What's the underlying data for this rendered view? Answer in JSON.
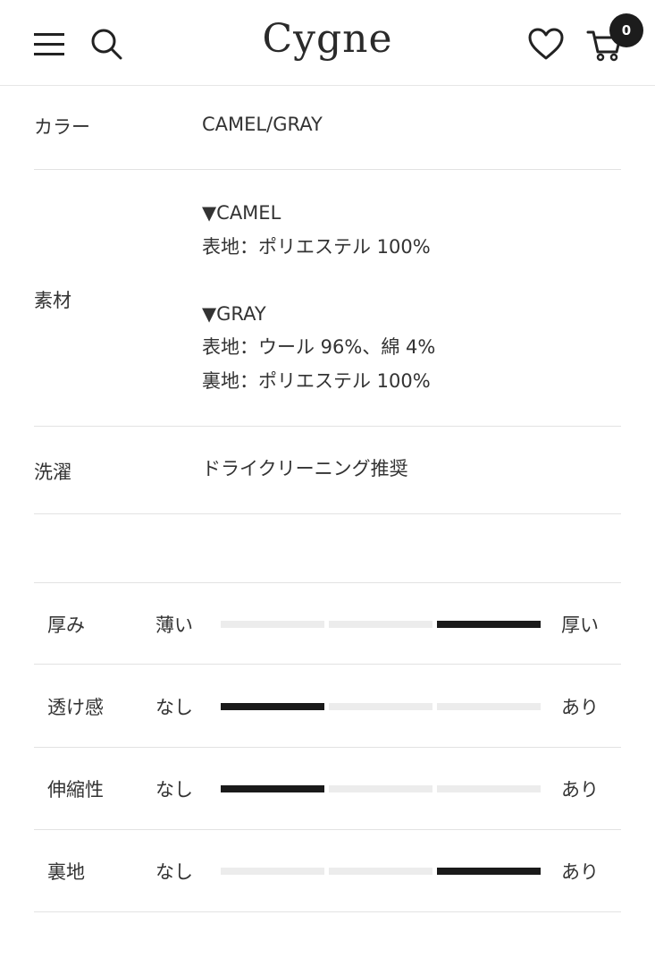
{
  "header": {
    "logo": "Cygne",
    "cart_count": "0"
  },
  "specs": {
    "color": {
      "label": "カラー",
      "value": "CAMEL/GRAY"
    },
    "material": {
      "label": "素材",
      "lines": [
        "▼CAMEL",
        "表地：ポリエステル 100%",
        "",
        "▼GRAY",
        "表地：ウール 96%、綿 4%",
        "裏地：ポリエステル 100%"
      ]
    },
    "washing": {
      "label": "洗濯",
      "value": "ドライクリーニング推奨"
    }
  },
  "ratings": [
    {
      "label": "厚み",
      "min": "薄い",
      "max": "厚い",
      "level": 3,
      "levels": 3
    },
    {
      "label": "透け感",
      "min": "なし",
      "max": "あり",
      "level": 1,
      "levels": 3
    },
    {
      "label": "伸縮性",
      "min": "なし",
      "max": "あり",
      "level": 1,
      "levels": 3
    },
    {
      "label": "裏地",
      "min": "なし",
      "max": "あり",
      "level": 3,
      "levels": 3
    }
  ],
  "icons": {
    "menu": "hamburger-menu-icon",
    "search": "search-icon",
    "wishlist": "heart-icon",
    "cart": "cart-icon"
  },
  "colors": {
    "text": "#222222",
    "active_segment": "#1a1a1a",
    "inactive_segment": "#ececec",
    "divider": "#e2e2e2",
    "badge": "#1c1c1c"
  }
}
